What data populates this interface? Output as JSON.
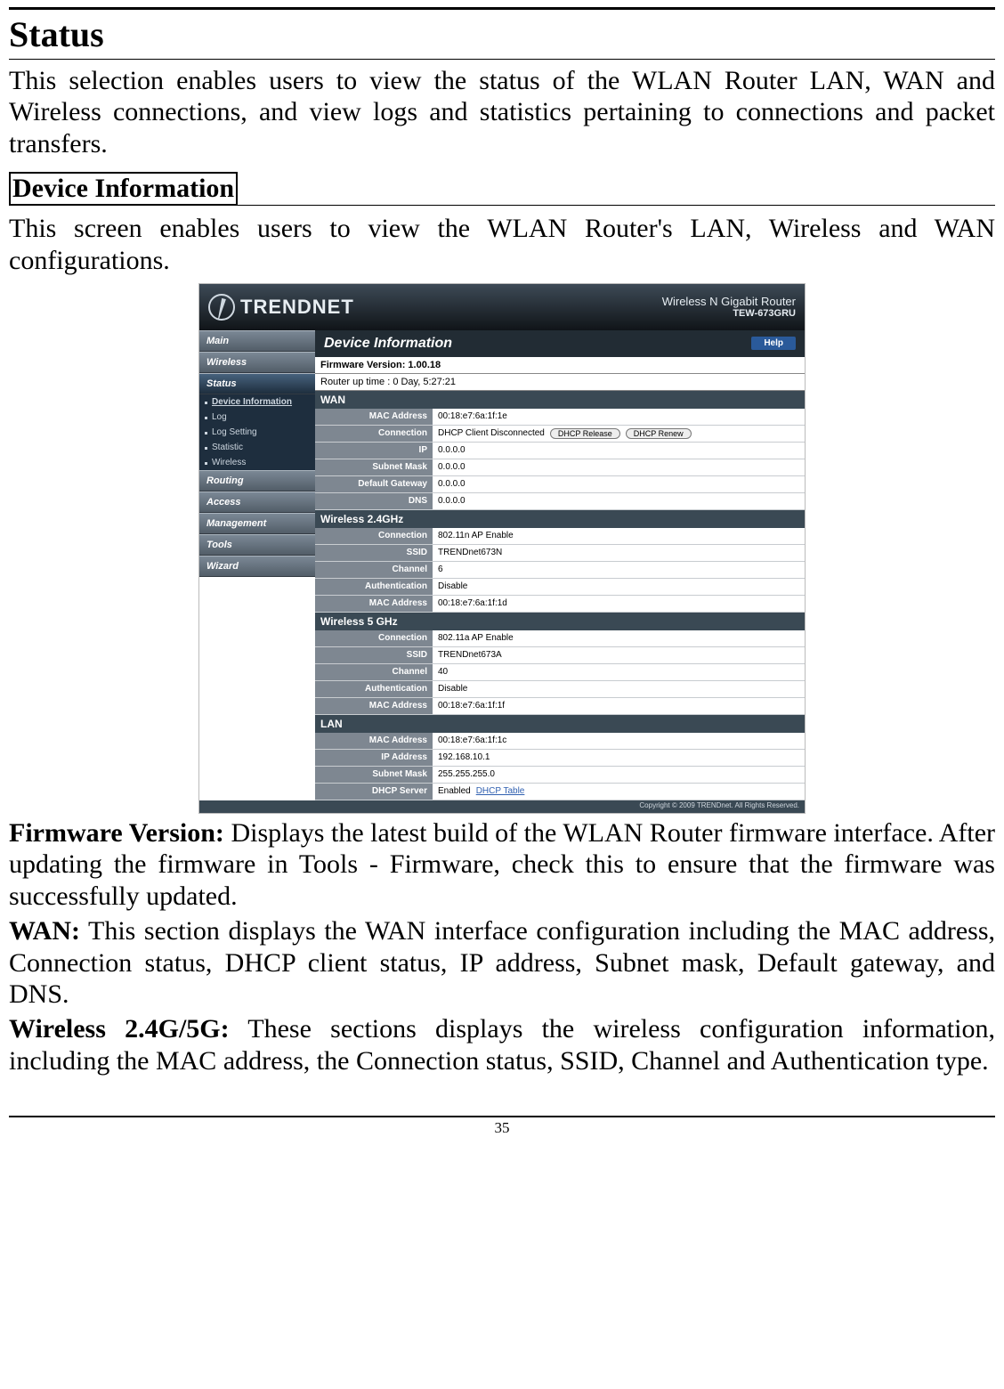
{
  "page_number": "35",
  "headings": {
    "status": "Status",
    "device_info": "Device Information"
  },
  "paragraphs": {
    "status_intro": "This selection enables users to view the status of the WLAN Router LAN, WAN and Wireless connections, and view logs and statistics pertaining to connections and packet transfers.",
    "devinfo_intro": "This screen enables users to view the WLAN Router's LAN, Wireless and WAN configurations."
  },
  "definitions": {
    "fw_label": "Firmware Version:",
    "fw_text": " Displays the latest build of the WLAN Router firmware interface. After updating the firmware in Tools - Firmware, check this to ensure that the firmware was successfully updated.",
    "wan_label": "WAN:",
    "wan_text": " This section displays the WAN interface configuration including the MAC address, Connection status, DHCP client status, IP address, Subnet mask, Default gateway, and DNS.",
    "wl_label": "Wireless 2.4G/5G:",
    "wl_text": " These sections displays the wireless configuration information, including the MAC address, the Connection status, SSID, Channel and Authentication type."
  },
  "router": {
    "brand": "TRENDNET",
    "model_line1": "Wireless N Gigabit Router",
    "model_line2": "TEW-673GRU",
    "sidebar": {
      "main": "Main",
      "wireless": "Wireless",
      "status": "Status",
      "sub_devinfo": "Device Information",
      "sub_log": "Log",
      "sub_logset": "Log Setting",
      "sub_stat": "Statistic",
      "sub_wl": "Wireless",
      "routing": "Routing",
      "access": "Access",
      "management": "Management",
      "tools": "Tools",
      "wizard": "Wizard"
    },
    "panel": {
      "title": "Device Information",
      "help": "Help",
      "fw_line": "Firmware Version: 1.00.18",
      "uptime_line": "Router up time :  0 Day, 5:27:21",
      "wan": {
        "header": "WAN",
        "mac_l": "MAC Address",
        "mac_v": "00:18:e7:6a:1f:1e",
        "conn_l": "Connection",
        "conn_v": "DHCP Client Disconnected",
        "btn_release": "DHCP Release",
        "btn_renew": "DHCP Renew",
        "ip_l": "IP",
        "ip_v": "0.0.0.0",
        "mask_l": "Subnet Mask",
        "mask_v": "0.0.0.0",
        "gw_l": "Default Gateway",
        "gw_v": "0.0.0.0",
        "dns_l": "DNS",
        "dns_v": "0.0.0.0"
      },
      "w24": {
        "header": "Wireless 2.4GHz",
        "conn_l": "Connection",
        "conn_v": "802.11n AP Enable",
        "ssid_l": "SSID",
        "ssid_v": "TRENDnet673N",
        "ch_l": "Channel",
        "ch_v": "6",
        "auth_l": "Authentication",
        "auth_v": "Disable",
        "mac_l": "MAC Address",
        "mac_v": "00:18:e7:6a:1f:1d"
      },
      "w5": {
        "header": "Wireless 5 GHz",
        "conn_l": "Connection",
        "conn_v": "802.11a AP Enable",
        "ssid_l": "SSID",
        "ssid_v": "TRENDnet673A",
        "ch_l": "Channel",
        "ch_v": "40",
        "auth_l": "Authentication",
        "auth_v": "Disable",
        "mac_l": "MAC Address",
        "mac_v": "00:18:e7:6a:1f:1f"
      },
      "lan": {
        "header": "LAN",
        "mac_l": "MAC Address",
        "mac_v": "00:18:e7:6a:1f:1c",
        "ip_l": "IP Address",
        "ip_v": "192.168.10.1",
        "mask_l": "Subnet Mask",
        "mask_v": "255.255.255.0",
        "dhcp_l": "DHCP Server",
        "dhcp_v": "Enabled",
        "dhcp_link": "DHCP Table"
      },
      "copyright": "Copyright © 2009 TRENDnet. All Rights Reserved."
    }
  }
}
